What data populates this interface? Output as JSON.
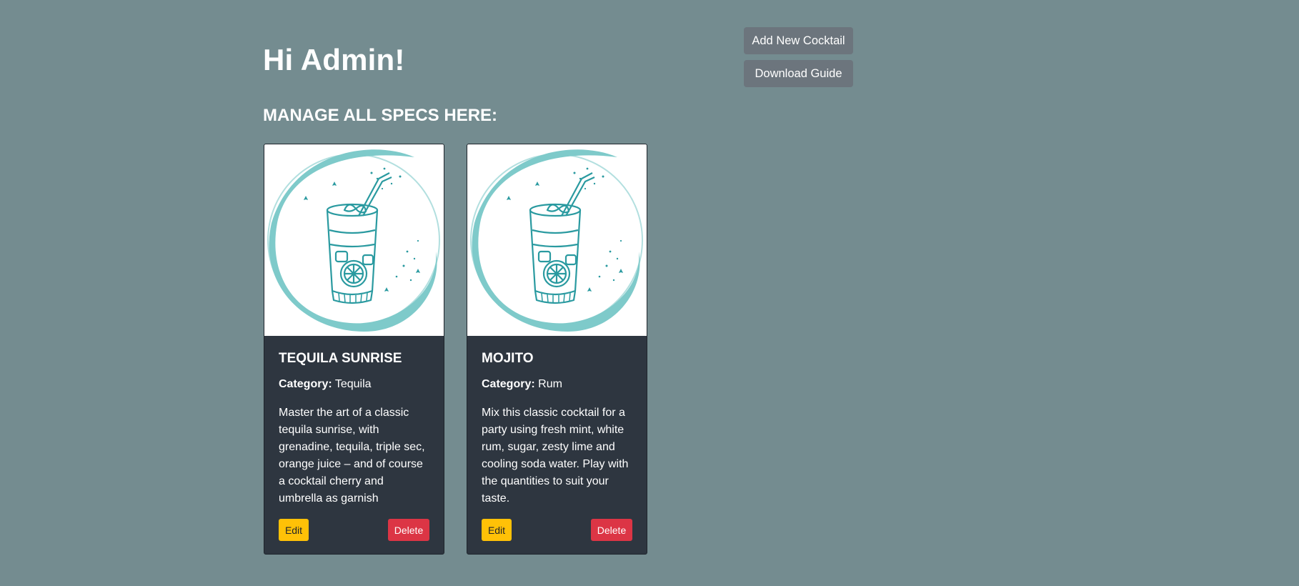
{
  "header": {
    "greeting": "Hi Admin!",
    "subheading": "MANAGE ALL SPECS HERE:"
  },
  "actions": {
    "add_label": "Add New Cocktail",
    "download_label": "Download Guide"
  },
  "cards": [
    {
      "title": "TEQUILA SUNRISE",
      "category_label": "Category:",
      "category": "Tequila",
      "description": "Master the art of a classic tequila sunrise, with grenadine, tequila, triple sec, orange juice – and of course a cocktail cherry and umbrella as garnish",
      "edit_label": "Edit",
      "delete_label": "Delete",
      "image_icon": "cocktail-glass-icon"
    },
    {
      "title": "MOJITO",
      "category_label": "Category:",
      "category": "Rum",
      "description": "Mix this classic cocktail for a party using fresh mint, white rum, sugar, zesty lime and cooling soda water. Play with the quantities to suit your taste.",
      "edit_label": "Edit",
      "delete_label": "Delete",
      "image_icon": "cocktail-glass-icon"
    }
  ],
  "colors": {
    "page_background": "#748c90",
    "card_background": "#2e3640",
    "secondary_button": "#6c757d",
    "edit_button": "#ffc107",
    "delete_button": "#dc3545",
    "illustration_teal": "#2a9aa0",
    "illustration_ring": "#7ecaca"
  }
}
